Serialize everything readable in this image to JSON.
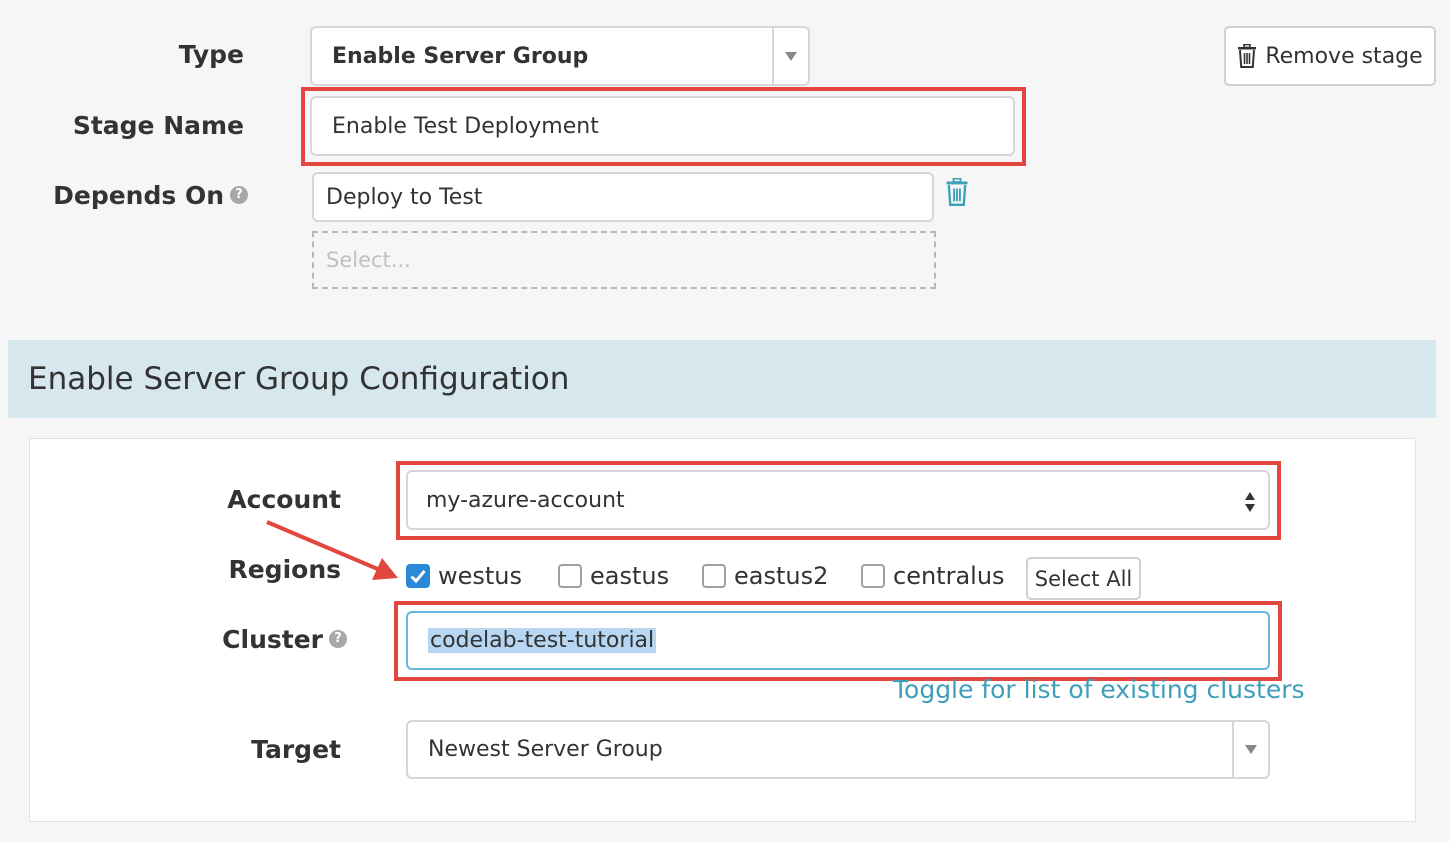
{
  "stage": {
    "type_label": "Type",
    "type_value": "Enable Server Group",
    "stage_name_label": "Stage Name",
    "stage_name_value": "Enable Test Deployment",
    "depends_on_label": "Depends On",
    "depends_on_value": "Deploy to Test",
    "depends_on_placeholder": "Select...",
    "remove_stage_label": "Remove stage",
    "help_glyph": "?"
  },
  "config": {
    "section_title": "Enable Server Group Configuration",
    "account_label": "Account",
    "account_value": "my-azure-account",
    "regions_label": "Regions",
    "regions": [
      {
        "name": "westus",
        "checked": true
      },
      {
        "name": "eastus",
        "checked": false
      },
      {
        "name": "eastus2",
        "checked": false
      },
      {
        "name": "centralus",
        "checked": false
      }
    ],
    "select_all_label": "Select All",
    "cluster_label": "Cluster",
    "cluster_value": "codelab-test-tutorial",
    "toggle_clusters_label": "Toggle for list of existing clusters",
    "target_label": "Target",
    "target_value": "Newest Server Group"
  },
  "colors": {
    "highlight_red": "#e2473f",
    "section_bg": "#d6e7ee",
    "link": "#3d9fb8",
    "checkbox_blue": "#2a88d8"
  },
  "icons": [
    "help-icon",
    "trash-icon",
    "caret-down-icon",
    "sort-arrows-icon",
    "check-icon",
    "arrow-annotation"
  ]
}
